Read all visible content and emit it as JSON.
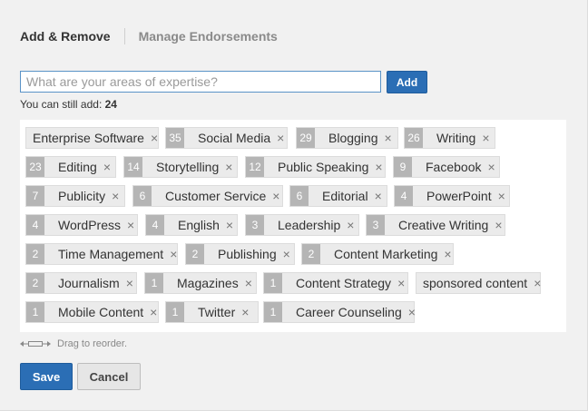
{
  "tabs": {
    "add_remove": "Add & Remove",
    "manage_endorsements": "Manage Endorsements"
  },
  "input": {
    "placeholder": "What are your areas of expertise?",
    "value": ""
  },
  "add_button": "Add",
  "remaining": {
    "label": "You can still add: ",
    "count": "24"
  },
  "remove_glyph": "×",
  "skills": [
    {
      "name": "Enterprise Software",
      "count": ""
    },
    {
      "name": "Social Media",
      "count": "35"
    },
    {
      "name": "Blogging",
      "count": "29"
    },
    {
      "name": "Writing",
      "count": "26"
    },
    {
      "name": "Editing",
      "count": "23"
    },
    {
      "name": "Storytelling",
      "count": "14"
    },
    {
      "name": "Public Speaking",
      "count": "12"
    },
    {
      "name": "Facebook",
      "count": "9"
    },
    {
      "name": "Publicity",
      "count": "7"
    },
    {
      "name": "Customer Service",
      "count": "6"
    },
    {
      "name": "Editorial",
      "count": "6"
    },
    {
      "name": "PowerPoint",
      "count": "4"
    },
    {
      "name": "WordPress",
      "count": "4"
    },
    {
      "name": "English",
      "count": "4"
    },
    {
      "name": "Leadership",
      "count": "3"
    },
    {
      "name": "Creative Writing",
      "count": "3"
    },
    {
      "name": "Time Management",
      "count": "2"
    },
    {
      "name": "Publishing",
      "count": "2"
    },
    {
      "name": "Content Marketing",
      "count": "2"
    },
    {
      "name": "Journalism",
      "count": "2"
    },
    {
      "name": "Magazines",
      "count": "1"
    },
    {
      "name": "Content Strategy",
      "count": "1"
    },
    {
      "name": "sponsored content",
      "count": ""
    },
    {
      "name": "Mobile Content",
      "count": "1"
    },
    {
      "name": "Twitter",
      "count": "1"
    },
    {
      "name": "Career Counseling",
      "count": "1"
    }
  ],
  "drag_hint": "Drag to reorder.",
  "save_button": "Save",
  "cancel_button": "Cancel",
  "colors": {
    "primary": "#2b6eb5",
    "count_badge": "#b5b5b5",
    "chip_bg": "#ebebeb"
  },
  "icons": {
    "drag": "drag-arrows-icon",
    "remove": "close-icon"
  }
}
